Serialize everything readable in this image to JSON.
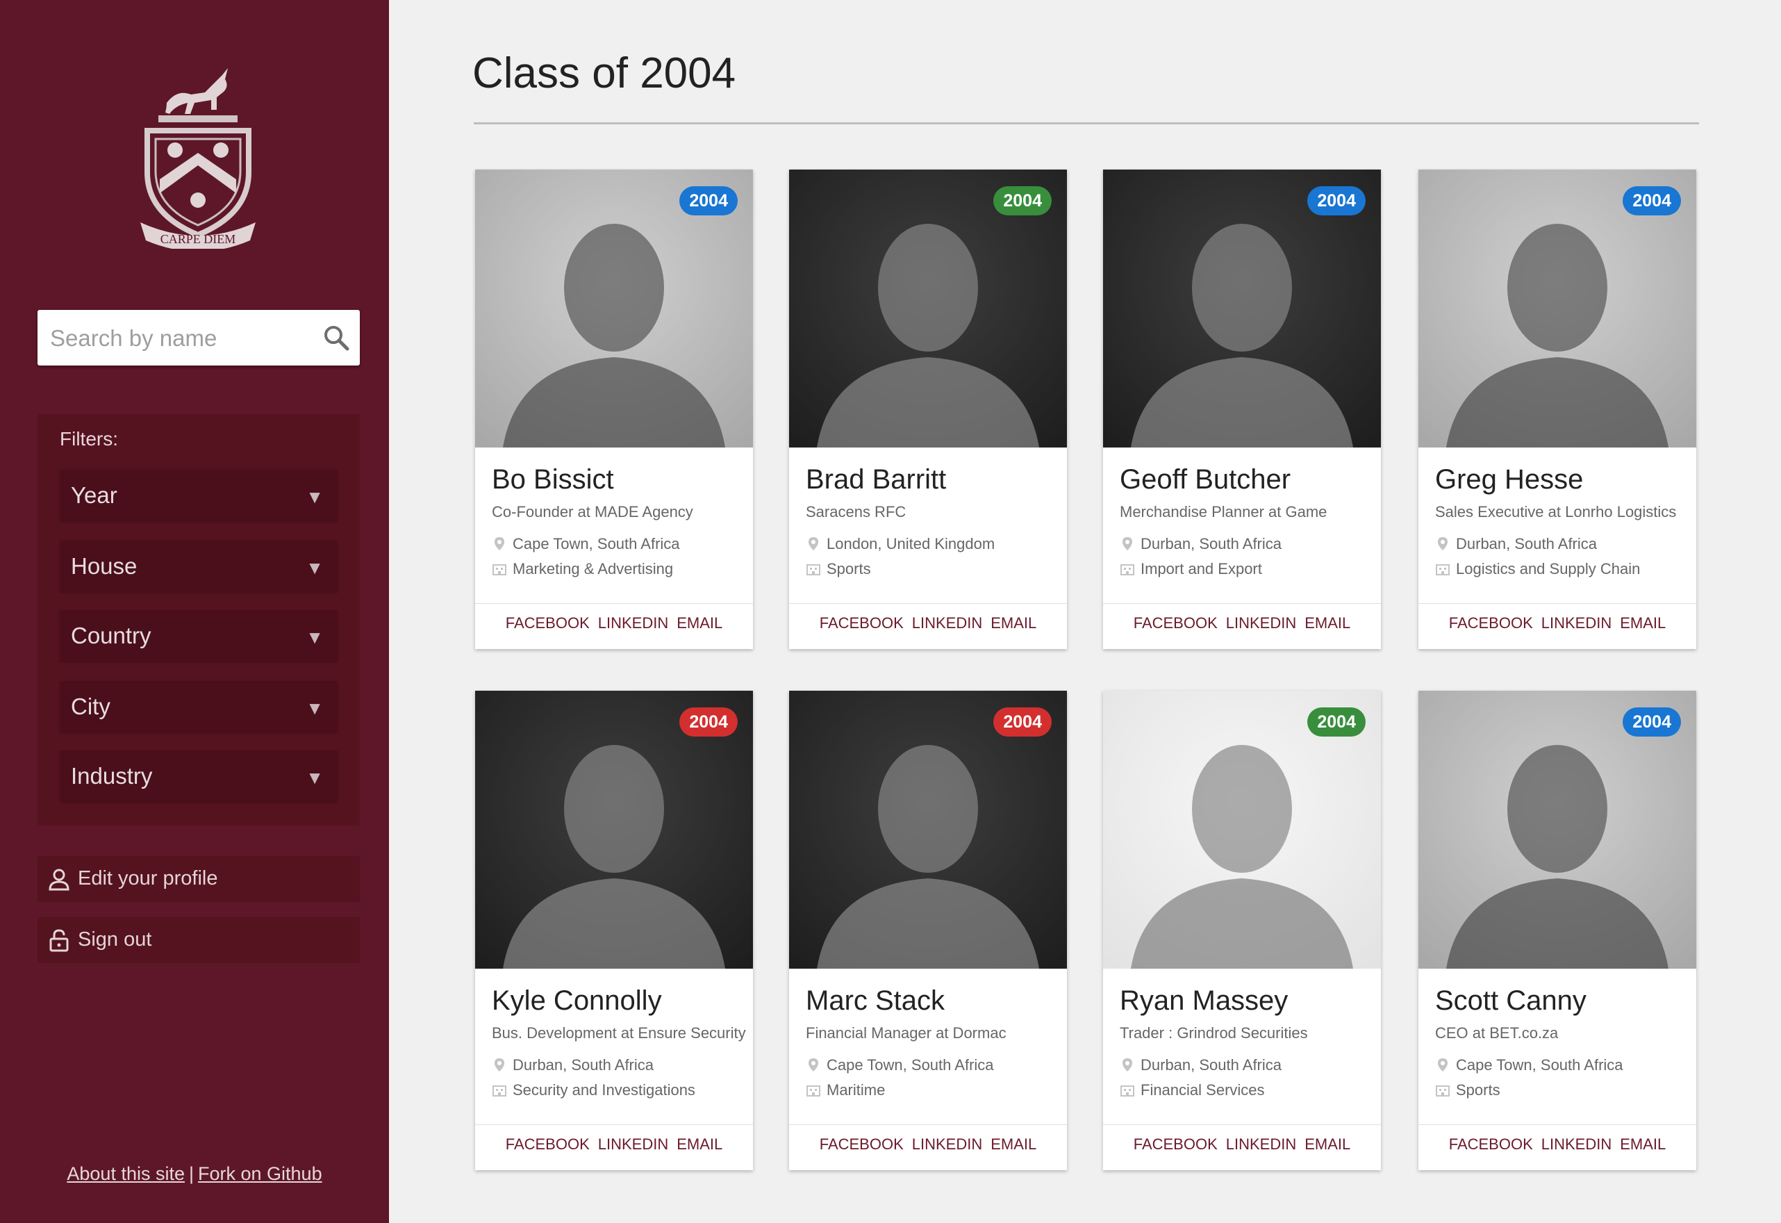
{
  "sidebar": {
    "crest_motto": "CARPE DIEM",
    "search": {
      "placeholder": "Search by name",
      "value": ""
    },
    "filters_label": "Filters:",
    "filters": [
      "Year",
      "House",
      "Country",
      "City",
      "Industry"
    ],
    "edit_profile_label": "Edit your profile",
    "sign_out_label": "Sign out",
    "footer": {
      "about": "About this site",
      "separator": "|",
      "github": "Fork on Github"
    }
  },
  "main": {
    "title": "Class of 2004",
    "card_actions": [
      "FACEBOOK",
      "LINKEDIN",
      "EMAIL"
    ],
    "cards": [
      {
        "name": "Bo Bissict",
        "job": "Co-Founder at MADE Agency",
        "location": "Cape Town, South Africa",
        "industry": "Marketing & Advertising",
        "year": "2004",
        "badge_color": "#1976d2",
        "photo_tone": "light"
      },
      {
        "name": "Brad Barritt",
        "job": "Saracens RFC",
        "location": "London, United Kingdom",
        "industry": "Sports",
        "year": "2004",
        "badge_color": "#388e3c",
        "photo_tone": "dark"
      },
      {
        "name": "Geoff Butcher",
        "job": "Merchandise Planner at Game",
        "location": "Durban, South Africa",
        "industry": "Import and Export",
        "year": "2004",
        "badge_color": "#1976d2",
        "photo_tone": "dark"
      },
      {
        "name": "Greg Hesse",
        "job": "Sales Executive at Lonrho Logistics",
        "location": "Durban, South Africa",
        "industry": "Logistics and Supply Chain",
        "year": "2004",
        "badge_color": "#1976d2",
        "photo_tone": "light"
      },
      {
        "name": "Kyle Connolly",
        "job": "Bus. Development at Ensure Security",
        "location": "Durban, South Africa",
        "industry": "Security and Investigations",
        "year": "2004",
        "badge_color": "#d32f2f",
        "photo_tone": "dark"
      },
      {
        "name": "Marc Stack",
        "job": "Financial Manager at Dormac",
        "location": "Cape Town, South Africa",
        "industry": "Maritime",
        "year": "2004",
        "badge_color": "#d32f2f",
        "photo_tone": "dark"
      },
      {
        "name": "Ryan Massey",
        "job": "Trader : Grindrod Securities",
        "location": "Durban, South Africa",
        "industry": "Financial Services",
        "year": "2004",
        "badge_color": "#388e3c",
        "photo_tone": "white"
      },
      {
        "name": "Scott Canny",
        "job": "CEO at BET.co.za",
        "location": "Cape Town, South Africa",
        "industry": "Sports",
        "year": "2004",
        "badge_color": "#1976d2",
        "photo_tone": "light"
      }
    ]
  },
  "colors": {
    "sidebar_bg": "#5e1728",
    "accent": "#6b1a2b",
    "badge_blue": "#1976d2",
    "badge_green": "#388e3c",
    "badge_red": "#d32f2f"
  }
}
